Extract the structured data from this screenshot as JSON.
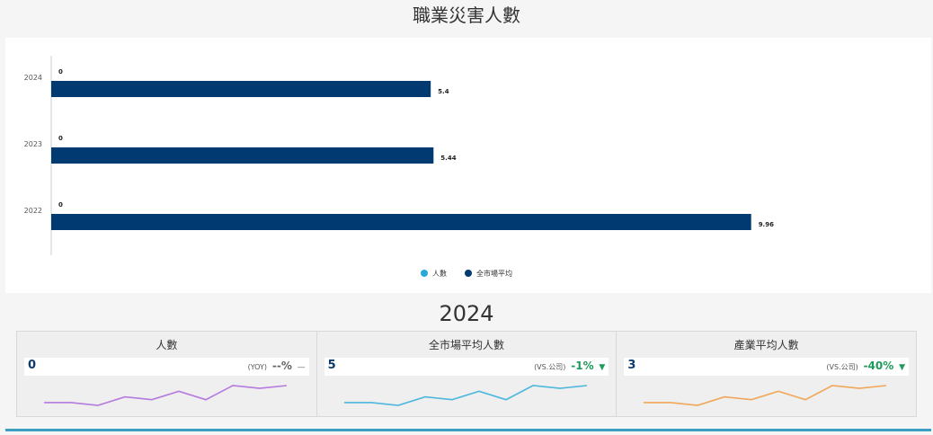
{
  "title": "職業災害人數",
  "chart_data": {
    "type": "bar",
    "orientation": "horizontal",
    "categories": [
      "2024",
      "2023",
      "2022"
    ],
    "series": [
      {
        "name": "人數",
        "values": [
          0,
          0,
          0
        ],
        "color": "#29a8d9"
      },
      {
        "name": "全市場平均",
        "values": [
          5.4,
          5.44,
          9.96
        ],
        "color": "#003a70"
      }
    ],
    "data_labels": [
      [
        "0",
        "0",
        "0"
      ],
      [
        "5.4",
        "5.44",
        "9.96"
      ]
    ],
    "xlim": [
      0,
      11
    ],
    "legend_placement": "bottom-center",
    "grid": false
  },
  "year": "2024",
  "cards": [
    {
      "title": "人數",
      "value": "0",
      "compare_label": "(YOY)",
      "compare_pct": "--%",
      "arrow": "—",
      "trend": "none",
      "spark_color": "#b57ae0",
      "spark": [
        4,
        4,
        3,
        6,
        5,
        8,
        5,
        10,
        9,
        10
      ]
    },
    {
      "title": "全市場平均人數",
      "value": "5",
      "compare_label": "(VS.公司)",
      "compare_pct": "-1%",
      "arrow": "▼",
      "trend": "down",
      "spark_color": "#4eb7dc",
      "spark": [
        4,
        4,
        3,
        6,
        5,
        8,
        5,
        10,
        9,
        10
      ]
    },
    {
      "title": "產業平均人數",
      "value": "3",
      "compare_label": "(VS.公司)",
      "compare_pct": "-40%",
      "arrow": "▼",
      "trend": "down",
      "spark_color": "#f1a75a",
      "spark": [
        4,
        4,
        3,
        6,
        5,
        8,
        5,
        10,
        9,
        10
      ]
    }
  ]
}
